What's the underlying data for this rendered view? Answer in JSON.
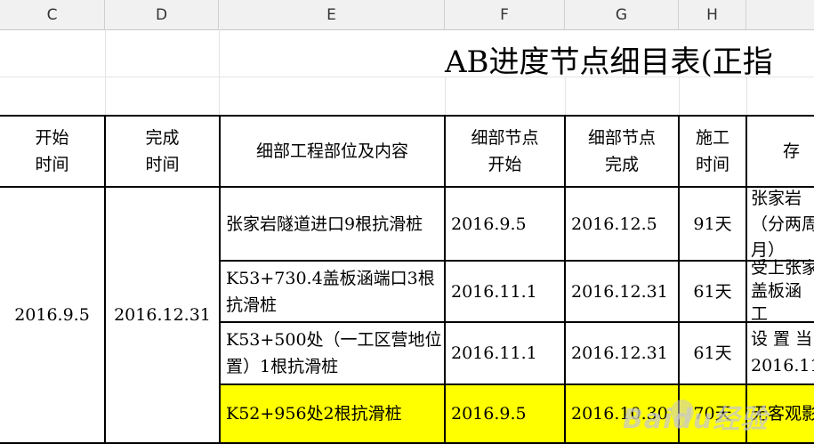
{
  "columns": [
    "C",
    "D",
    "E",
    "F",
    "G",
    "H",
    ""
  ],
  "title": "AB进度节点细目表(正指",
  "headers": {
    "start_time": [
      "开始",
      "时间"
    ],
    "end_time": [
      "完成",
      "时间"
    ],
    "content": "细部工程部位及内容",
    "node_start": [
      "细部节点",
      "开始"
    ],
    "node_end": [
      "细部节点",
      "完成"
    ],
    "duration": [
      "施工",
      "时间"
    ],
    "remark": "存"
  },
  "merged": {
    "start": "2016.9.5",
    "end": "2016.12.31"
  },
  "rows": [
    {
      "content": "张家岩隧道进口9根抗滑桩",
      "node_start": "2016.9.5",
      "node_end": "2016.12.5",
      "duration": "91天",
      "remark": [
        "张家岩",
        "（分两周",
        "月）"
      ]
    },
    {
      "content": "K53+730.4盖板涵端口3根抗滑桩",
      "node_start": "2016.11.1",
      "node_end": "2016.12.31",
      "duration": "61天",
      "remark": [
        "受上张家",
        "盖板涵",
        "工"
      ]
    },
    {
      "content": "K53+500处（一工区营地位置）1根抗滑桩",
      "node_start": "2016.11.1",
      "node_end": "2016.12.31",
      "duration": "61天",
      "remark": [
        "设 置 当",
        "2016.11"
      ]
    },
    {
      "content": "K52+956处2根抗滑桩",
      "node_start": "2016.9.5",
      "node_end": "2016.10.30",
      "duration": "70天",
      "remark": [
        "无客观影"
      ],
      "highlight": "#ffff00"
    }
  ],
  "watermark": "Baidu经验"
}
